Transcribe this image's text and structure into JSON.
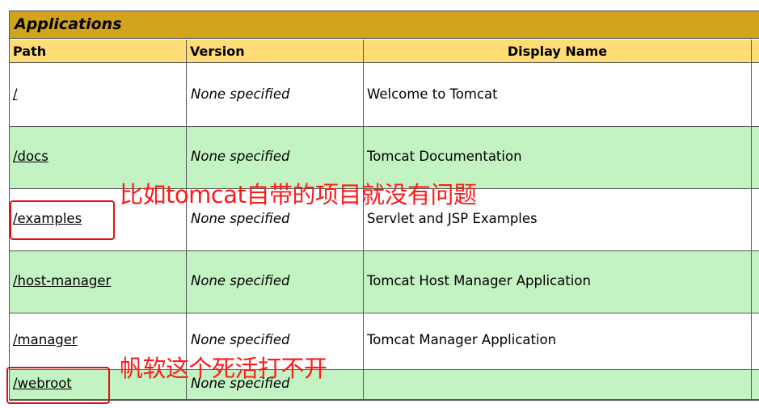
{
  "section_title": "Applications",
  "columns": {
    "path": "Path",
    "version": "Version",
    "display_name": "Display Name"
  },
  "rows": [
    {
      "path": "/",
      "version": "None specified",
      "display_name": "Welcome to Tomcat",
      "bg": "white"
    },
    {
      "path": "/docs",
      "version": "None specified",
      "display_name": "Tomcat Documentation",
      "bg": "green"
    },
    {
      "path": "/examples",
      "version": "None specified",
      "display_name": "Servlet and JSP Examples",
      "bg": "white"
    },
    {
      "path": "/host-manager",
      "version": "None specified",
      "display_name": "Tomcat Host Manager Application",
      "bg": "green"
    },
    {
      "path": "/manager",
      "version": "None specified",
      "display_name": "Tomcat Manager Application",
      "bg": "white"
    },
    {
      "path": "/webroot",
      "version": "None specified",
      "display_name": "",
      "bg": "green"
    }
  ],
  "annotations": {
    "top": "比如tomcat自带的项目就没有问题",
    "bottom": "帆软这个死活打不开"
  },
  "colors": {
    "title_bg": "#d2a41c",
    "header_bg": "#ffdc75",
    "row_green": "#c3f3c3",
    "annotation_red": "#ff1a1a"
  }
}
